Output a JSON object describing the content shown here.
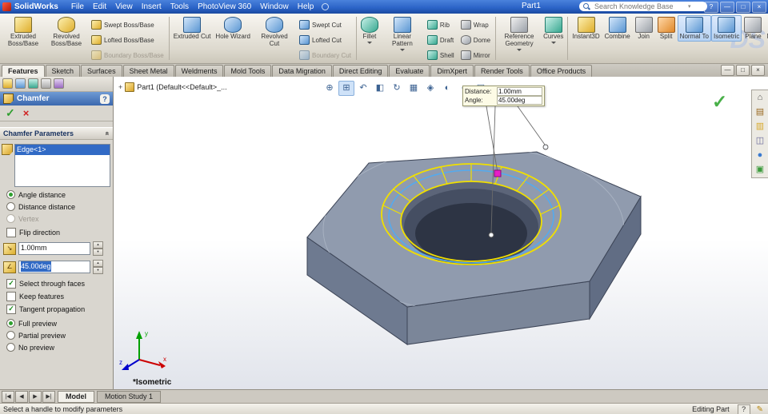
{
  "colors": {
    "accent": "#316ac5",
    "yellow": "#f0df00",
    "edgeblue": "#54aaee",
    "magenta": "#e81ec8",
    "titlebar_blue": "#2a62c6",
    "model_gray": "#909bae"
  },
  "titlebar": {
    "app_name": "SolidWorks",
    "document_title": "Part1",
    "search_placeholder": "Search Knowledge Base",
    "menus": [
      {
        "label": "File"
      },
      {
        "label": "Edit"
      },
      {
        "label": "View"
      },
      {
        "label": "Insert"
      },
      {
        "label": "Tools"
      },
      {
        "label": "PhotoView 360"
      },
      {
        "label": "Window"
      },
      {
        "label": "Help"
      }
    ],
    "window": {
      "help": "?",
      "min": "—",
      "restore": "□",
      "close": "×"
    }
  },
  "ribbon": {
    "logo": "DS",
    "labels": {
      "extruded_boss": "Extruded Boss/Base",
      "revolved_boss": "Revolved Boss/Base",
      "swept_boss": "Swept Boss/Base",
      "lofted_boss": "Lofted Boss/Base",
      "boundary_boss": "Boundary Boss/Base",
      "extruded_cut": "Extruded Cut",
      "hole_wizard": "Hole Wizard",
      "revolved_cut": "Revolved Cut",
      "swept_cut": "Swept Cut",
      "lofted_cut": "Lofted Cut",
      "boundary_cut": "Boundary Cut",
      "fillet": "Fillet",
      "linear_pattern": "Linear Pattern",
      "rib": "Rib",
      "draft": "Draft",
      "shell": "Shell",
      "wrap": "Wrap",
      "dome": "Dome",
      "mirror": "Mirror",
      "reference_geometry": "Reference Geometry",
      "curves": "Curves",
      "instant3d": "Instant3D",
      "combine": "Combine",
      "join": "Join",
      "split": "Split",
      "normal_to": "Normal To",
      "isometric": "Isometric",
      "plane": "Plane",
      "measure": "Measure"
    }
  },
  "tabs": {
    "items": [
      {
        "label": "Features"
      },
      {
        "label": "Sketch"
      },
      {
        "label": "Surfaces"
      },
      {
        "label": "Sheet Metal"
      },
      {
        "label": "Weldments"
      },
      {
        "label": "Mold Tools"
      },
      {
        "label": "Data Migration"
      },
      {
        "label": "Direct Editing"
      },
      {
        "label": "Evaluate"
      },
      {
        "label": "DimXpert"
      },
      {
        "label": "Render Tools"
      },
      {
        "label": "Office Products"
      }
    ],
    "doc_window": {
      "min": "—",
      "restore": "□",
      "close": "×"
    }
  },
  "property_manager": {
    "title": "Chamfer",
    "help_glyph": "?",
    "ok_glyph": "✓",
    "cancel_glyph": "×",
    "group_title": "Chamfer Parameters",
    "collapse_glyph": "«",
    "selection_items": [
      {
        "label": "Edge<1>"
      }
    ],
    "type_options": [
      {
        "label": "Angle distance"
      },
      {
        "label": "Distance distance"
      },
      {
        "label": "Vertex"
      }
    ],
    "flip_label": "Flip direction",
    "distance_value": "1.00mm",
    "angle_value": "45.00deg",
    "icons": {
      "distance": "↘",
      "angle": "∠"
    },
    "check_glyph": "✓",
    "spin_up": "▲",
    "spin_down": "▼",
    "face_options": [
      {
        "label": "Select through faces"
      },
      {
        "label": "Keep features"
      },
      {
        "label": "Tangent propagation"
      }
    ],
    "preview_options": [
      {
        "label": "Full preview"
      },
      {
        "label": "Partial preview"
      },
      {
        "label": "No preview"
      }
    ]
  },
  "viewport": {
    "breadcrumb_expand": "+",
    "breadcrumb": "Part1 (Default<<Default>_...",
    "headsup": [
      {
        "name": "zoom-to-fit",
        "glyph": "⊕"
      },
      {
        "name": "zoom-to-area",
        "glyph": "⊞"
      },
      {
        "name": "previous-view",
        "glyph": "↶"
      },
      {
        "name": "section-view",
        "glyph": "◧"
      },
      {
        "name": "rotate-view",
        "glyph": "↻"
      },
      {
        "name": "view-orientation",
        "glyph": "▦"
      },
      {
        "name": "display-style",
        "glyph": "◈"
      },
      {
        "name": "hide-show-items",
        "glyph": "◐"
      },
      {
        "name": "edit-appearance",
        "glyph": "●"
      },
      {
        "name": "apply-scene",
        "glyph": "▣"
      }
    ],
    "confirm": {
      "ok": "✓",
      "cancel": "×"
    },
    "callout": {
      "distance_label": "Distance:",
      "distance_value": "1.00mm",
      "angle_label": "Angle:",
      "angle_value": "45.00deg"
    },
    "taskpane": [
      {
        "name": "solidworks-resources",
        "glyph": "⌂"
      },
      {
        "name": "design-library",
        "glyph": "▤"
      },
      {
        "name": "file-explorer",
        "glyph": "▥"
      },
      {
        "name": "view-palette",
        "glyph": "◫"
      },
      {
        "name": "appearances-scenes",
        "glyph": "●"
      },
      {
        "name": "custom-properties",
        "glyph": "▣"
      }
    ],
    "triad": {
      "x": "x",
      "y": "y",
      "z": "z"
    },
    "view_label": "*Isometric"
  },
  "bottom_tabs": {
    "nav": [
      "|◀",
      "◀",
      "▶",
      "▶|"
    ],
    "items": [
      {
        "label": "Model"
      },
      {
        "label": "Motion Study 1"
      }
    ]
  },
  "statusbar": {
    "message": "Select a handle to modify parameters",
    "mode": "Editing Part",
    "help": "?",
    "pencil": "✎"
  }
}
